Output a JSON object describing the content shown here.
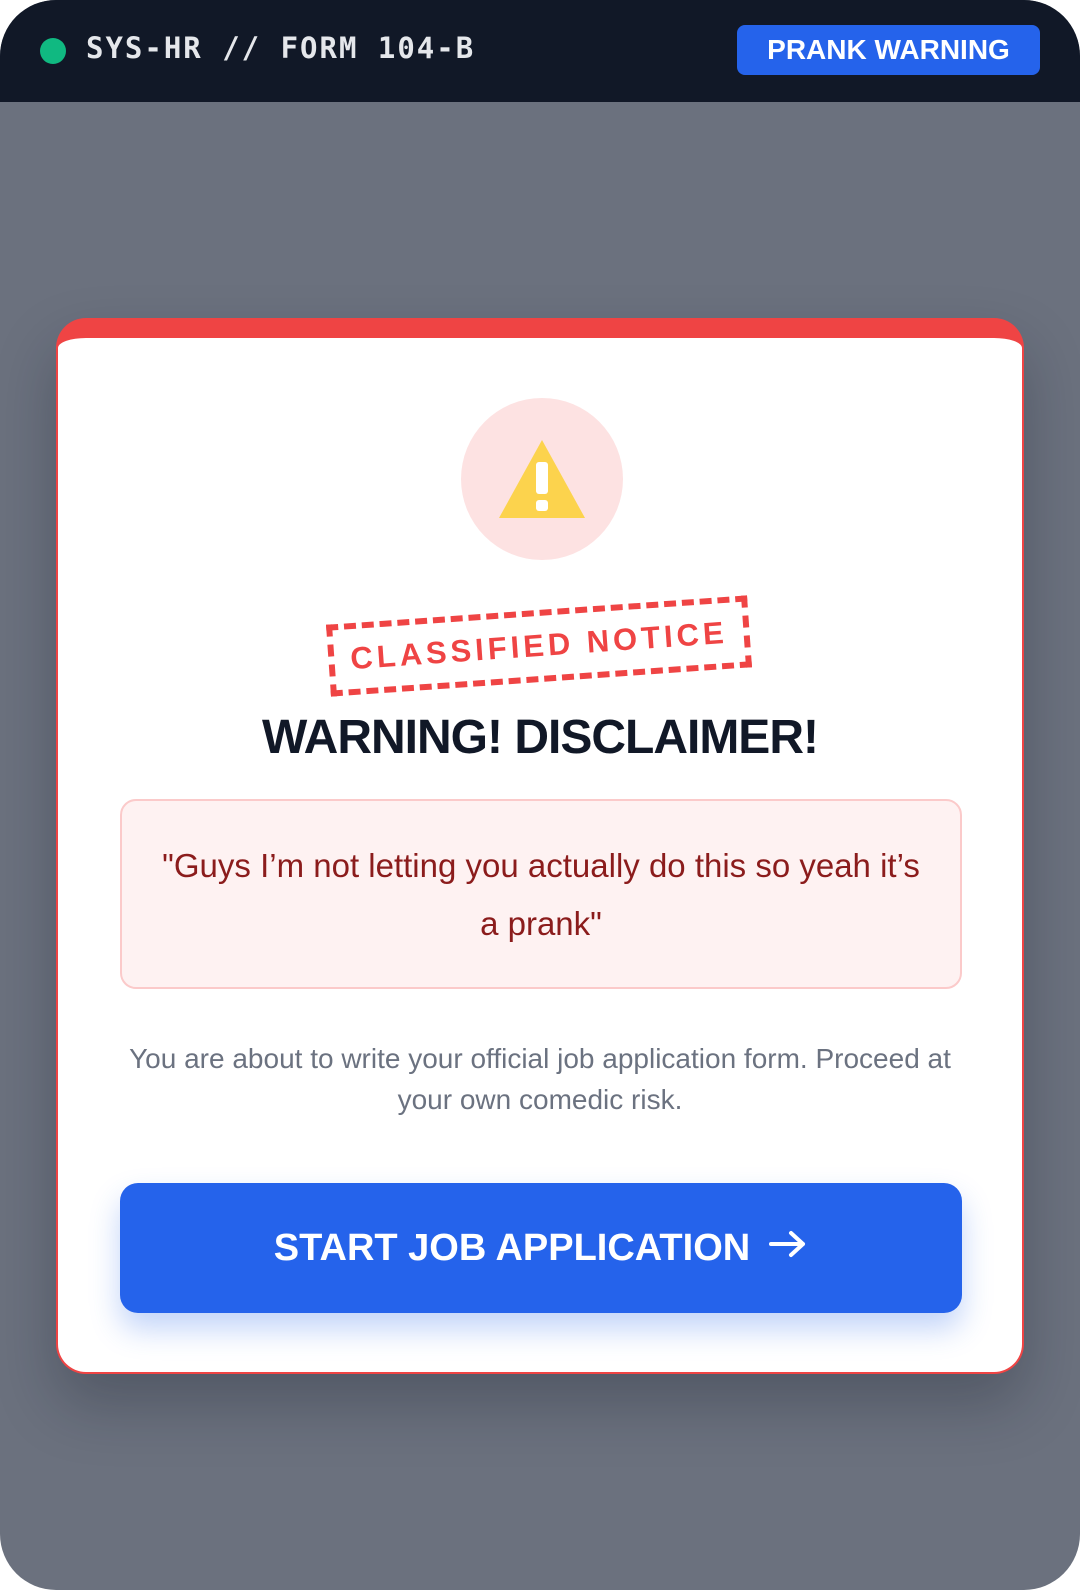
{
  "topbar": {
    "title": "SYS-HR // FORM 104-B",
    "badge": "PRANK WARNING"
  },
  "card": {
    "icon": "warning-triangle-icon",
    "stamp": "CLASSIFIED NOTICE",
    "heading": "WARNING! DISCLAIMER!",
    "quote": "\"Guys I’m not letting you actually do this so yeah it’s a prank\"",
    "description": "You are about to write your official job application form. Proceed at your own comedic risk.",
    "button_label": "START JOB APPLICATION",
    "button_icon": "arrow-right-icon"
  },
  "colors": {
    "accent_blue": "#2563eb",
    "alert_red": "#ef4444",
    "status_green": "#10b981",
    "topbar_bg": "#111827",
    "warning_yellow": "#fcd34d"
  }
}
